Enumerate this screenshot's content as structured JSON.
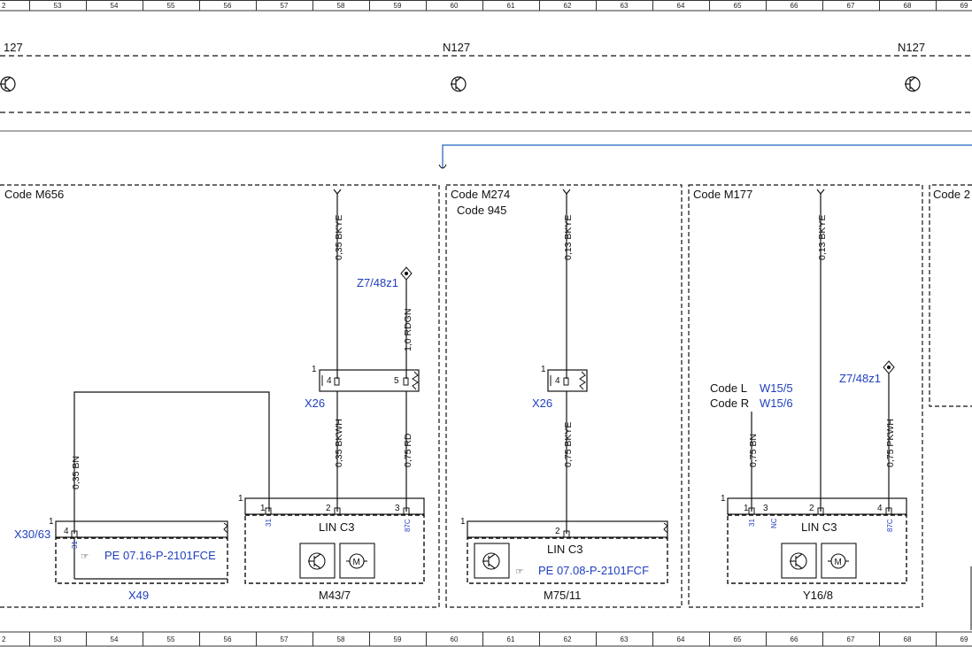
{
  "grid": {
    "columns": [
      "2",
      "53",
      "54",
      "55",
      "56",
      "57",
      "58",
      "59",
      "60",
      "61",
      "62",
      "63",
      "64",
      "65",
      "66",
      "67",
      "68",
      "69"
    ]
  },
  "top_row": {
    "labels": [
      "127",
      "N127",
      "N127"
    ]
  },
  "sections": {
    "m656": {
      "code": "Code M656"
    },
    "m274": {
      "code": "Code M274",
      "code2": "Code 945"
    },
    "m177": {
      "code": "Code M177"
    },
    "right": {
      "code": "Code 2"
    }
  },
  "wires": {
    "w1": "0,35 BKYE",
    "w2": "1,0 RDGN",
    "w3": "0,35 BKWH",
    "w4": "0,75 RD",
    "w5": "0,35 BN",
    "w6": "0,13 BKYE",
    "w7": "0,75 BKYE",
    "w8": "0,13 BKYE",
    "w9": "0,75 BN",
    "w10": "0,75 PKWH"
  },
  "connectors": {
    "z7_1": "Z7/48z1",
    "z7_2": "Z7/48z1",
    "x26_1": "X26",
    "x26_2": "X26",
    "x30": "X30/63",
    "x49": "X49",
    "w15_5": "W15/5",
    "w15_6": "W15/6",
    "code_l": "Code L",
    "code_r": "Code R"
  },
  "components": {
    "m43": "M43/7",
    "m75": "M75/11",
    "y16": "Y16/8",
    "lin1": "LIN C3",
    "lin2": "LIN C3",
    "lin3": "LIN C3",
    "pe1": "PE 07.16-P-2101FCE",
    "pe2": "PE 07.08-P-2101FCF"
  },
  "pins": {
    "p1": "1",
    "p2": "2",
    "p3": "3",
    "p4": "4",
    "p5": "5",
    "p31": "31",
    "p87c": "87C",
    "pnc": "NC"
  }
}
